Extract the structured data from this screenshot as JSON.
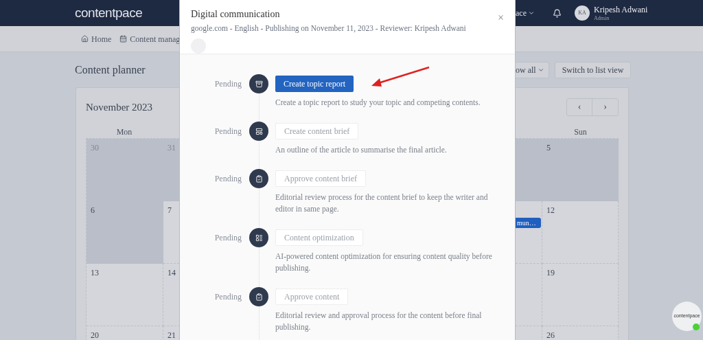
{
  "header": {
    "logo": "contentpace",
    "workspace": "ace",
    "user": {
      "initials": "KA",
      "name": "Kripesh Adwani",
      "role": "Admin"
    }
  },
  "nav": [
    {
      "label": "Home"
    },
    {
      "label": "Content manag"
    }
  ],
  "page_title": "Content planner",
  "toolbar_buttons": [
    {
      "label": "ow all",
      "kind": "dropdown"
    },
    {
      "label": "Switch to list view",
      "kind": "plain"
    }
  ],
  "calendar": {
    "month": "November 2023",
    "prev": "‹",
    "next": "›",
    "weekday_left": "Mon",
    "weekday_right": "Sun",
    "rows": [
      {
        "mon": {
          "day": "30",
          "shaded": true,
          "outside_month": true
        },
        "tue": {
          "day": "31",
          "shaded": true,
          "outside_month": true
        },
        "sat": {
          "shaded": true
        },
        "sun": {
          "day": "5",
          "shaded": true,
          "outside_month": false
        }
      },
      {
        "mon": {
          "day": "6",
          "shaded": true,
          "outside_month": false
        },
        "tue": {
          "day": "7",
          "shaded": false,
          "outside_month": false
        },
        "sat": {
          "shaded": false,
          "event": "mun…"
        },
        "sun": {
          "day": "12",
          "shaded": false,
          "outside_month": false
        }
      },
      {
        "mon": {
          "day": "13",
          "shaded": false,
          "outside_month": false
        },
        "tue": {
          "day": "14",
          "shaded": false,
          "outside_month": false
        },
        "sat": {
          "shaded": false
        },
        "sun": {
          "day": "19",
          "shaded": false,
          "outside_month": false
        }
      },
      {
        "mon": {
          "day": "20",
          "shaded": false,
          "outside_month": false
        },
        "tue": {
          "day": "21",
          "shaded": false,
          "outside_month": false
        },
        "sat": {
          "shaded": false
        },
        "sun": {
          "day": "26",
          "shaded": false,
          "outside_month": false
        }
      }
    ]
  },
  "modal": {
    "title": "Digital communication",
    "subtitle": "google.com - English - Publishing on November 11, 2023 - Reviewer: Kripesh Adwani",
    "close": "×",
    "steps": [
      {
        "status": "Pending",
        "kind": "report",
        "action": "Create topic report",
        "primary": true,
        "description": "Create a topic report to study your topic and competing contents."
      },
      {
        "status": "Pending",
        "kind": "brief",
        "action": "Create content brief",
        "primary": false,
        "description": "An outline of the article to summarise the final article."
      },
      {
        "status": "Pending",
        "kind": "approve",
        "action": "Approve content brief",
        "primary": false,
        "description": "Editorial review process for the content brief to keep the writer and editor in same page."
      },
      {
        "status": "Pending",
        "kind": "optimize",
        "action": "Content optimization",
        "primary": false,
        "description": "AI-powered content optimization for ensuring content quality before publishing."
      },
      {
        "status": "Pending",
        "kind": "approve",
        "action": "Approve content",
        "primary": false,
        "description": "Editorial review and approval process for the content before final publishing."
      }
    ]
  },
  "chat_widget": {
    "label": "contentpace",
    "online": true
  }
}
